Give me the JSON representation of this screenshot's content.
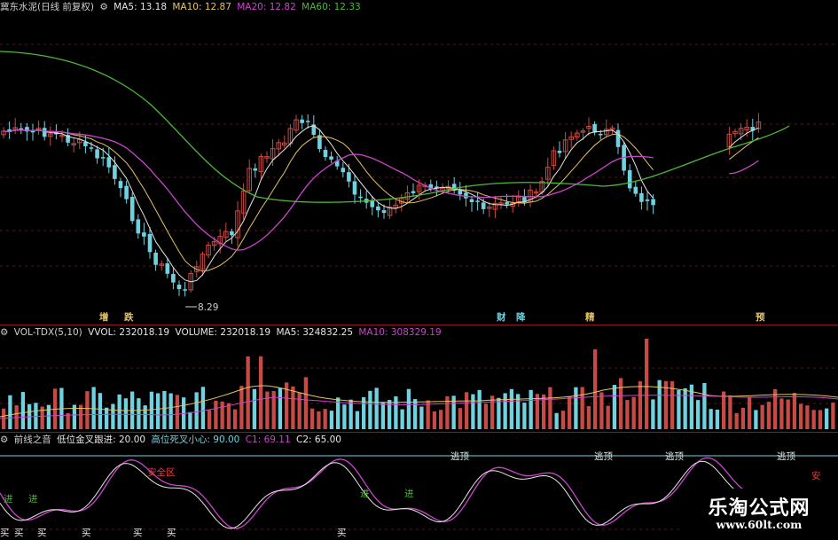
{
  "colors": {
    "up": "#c84a44",
    "down": "#6fd2e0",
    "ma5": "#e6e6e6",
    "ma10": "#e6c463",
    "ma20": "#cc44cc",
    "ma60": "#4fb83a"
  },
  "main_header": {
    "stock_name": "冀东水泥(日线 前复权)",
    "ma5_label": "MA5:",
    "ma5_value": "13.18",
    "ma10_label": "MA10:",
    "ma10_value": "12.87",
    "ma20_label": "MA20:",
    "ma20_value": "12.82",
    "ma60_label": "MA60:",
    "ma60_value": "12.33"
  },
  "vol_header": {
    "indicator": "VOL-TDX(5,10)",
    "vvol_label": "VVOL:",
    "vvol_value": "232018.19",
    "volume_label": "VOLUME:",
    "volume_value": "232018.19",
    "ma5_label": "MA5:",
    "ma5_value": "324832.25",
    "ma10_label": "MA10:",
    "ma10_value": "308329.19"
  },
  "ind_header": {
    "name": "前线之音",
    "low_label": "低位金叉跟进:",
    "low_value": "20.00",
    "high_label": "高位死叉小心:",
    "high_value": "90.00",
    "c1_label": "C1:",
    "c1_value": "69.11",
    "c2_label": "C2:",
    "c2_value": "65.00"
  },
  "low_price_label": "8.29",
  "markers": [
    {
      "text": "增",
      "color": "#e6c463"
    },
    {
      "text": "跌",
      "color": "#e6c463"
    },
    {
      "text": "财",
      "color": "#6fd2e0"
    },
    {
      "text": "降",
      "color": "#6fd2e0"
    },
    {
      "text": "精",
      "color": "#e6c463"
    },
    {
      "text": "预",
      "color": "#e6c463"
    }
  ],
  "signals": [
    {
      "text": "逃顶"
    },
    {
      "text": "逃顶"
    },
    {
      "text": "逃顶"
    },
    {
      "text": "逃顶"
    },
    {
      "text": "安全区"
    },
    {
      "text": "安"
    },
    {
      "text": "买"
    },
    {
      "text": "买"
    },
    {
      "text": "买"
    },
    {
      "text": "买"
    },
    {
      "text": "买"
    },
    {
      "text": "买"
    },
    {
      "text": "买"
    },
    {
      "text": "进"
    },
    {
      "text": "进"
    },
    {
      "text": "进"
    },
    {
      "text": "进"
    }
  ],
  "watermark": {
    "title": "乐淘公式网",
    "url": "www.60lt.com"
  }
}
